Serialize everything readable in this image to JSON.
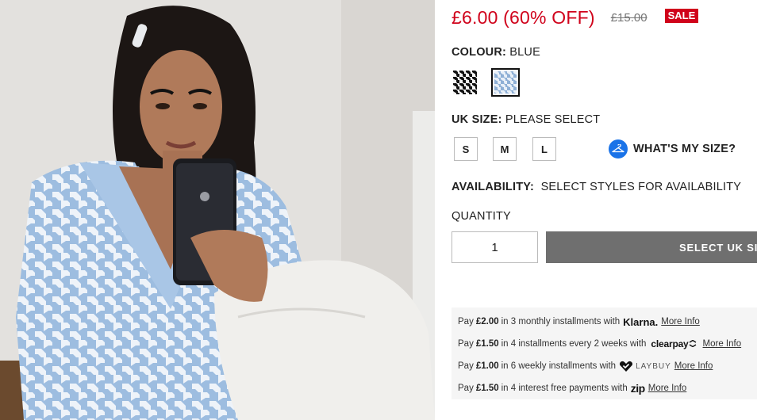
{
  "price": {
    "current": "£6.00 (60% OFF)",
    "was": "£15.00",
    "badge": "SALE"
  },
  "colour": {
    "label": "COLOUR:",
    "value": "BLUE",
    "swatches": [
      "black houndstooth",
      "blue houndstooth"
    ],
    "selected": "blue houndstooth"
  },
  "size": {
    "label": "UK SIZE:",
    "value": "PLEASE SELECT",
    "options": [
      "S",
      "M",
      "L"
    ],
    "whats_my_size": "WHAT'S MY SIZE?"
  },
  "availability": {
    "label": "AVAILABILITY:",
    "value": "SELECT STYLES FOR AVAILABILITY"
  },
  "quantity": {
    "label": "QUANTITY",
    "value": "1"
  },
  "select_button": "SELECT UK SIZE",
  "payments": [
    {
      "prefix": "Pay",
      "amount": "£2.00",
      "text": "in 3 monthly installments with",
      "provider": "Klarna.",
      "link": "More Info"
    },
    {
      "prefix": "Pay",
      "amount": "£1.50",
      "text": "in 4 installments every 2 weeks with",
      "provider": "clearpay",
      "link": "More Info"
    },
    {
      "prefix": "Pay",
      "amount": "£1.00",
      "text": "in 6 weekly installments with",
      "provider": "LAYBUY",
      "link": "More Info"
    },
    {
      "prefix": "Pay",
      "amount": "£1.50",
      "text": "in 4 interest free payments with",
      "provider": "zip",
      "link": "More Info"
    }
  ],
  "colors": {
    "sale_red": "#d0021b",
    "button_grey": "#6f6f6f",
    "accent_blue": "#1a73e8"
  }
}
